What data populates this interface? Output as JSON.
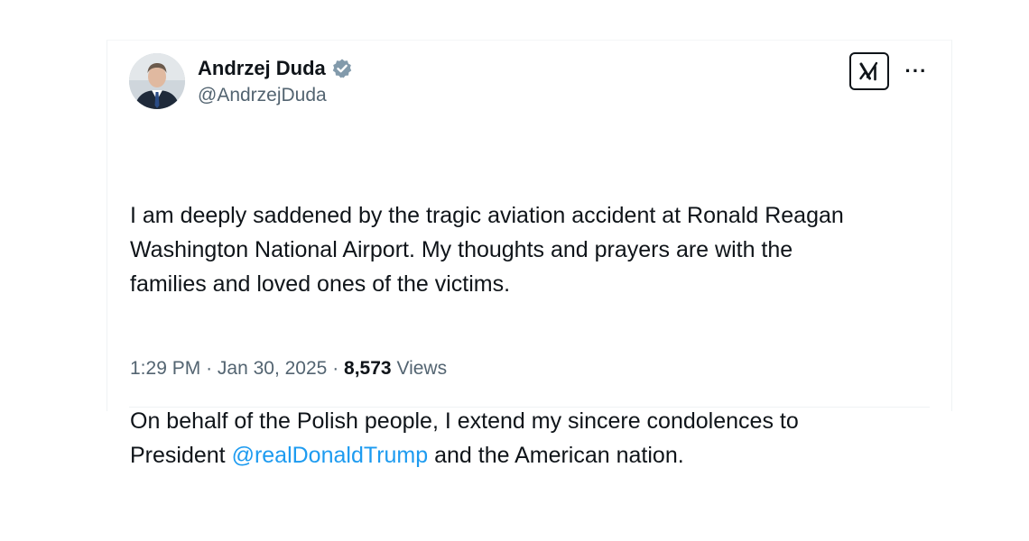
{
  "author": {
    "display_name": "Andrzej Duda",
    "handle": "@AndrzejDuda",
    "verified": true,
    "avatar": "profile-photo"
  },
  "actions": {
    "grok_icon": "grok-icon",
    "more_icon": "more-options-icon",
    "more_label": "···"
  },
  "tweet": {
    "paragraph1": "I am deeply saddened by the tragic aviation accident at Ronald Reagan\nWashington National Airport. My thoughts and prayers are with the\nfamilies and loved ones of the victims.",
    "paragraph2_before": "On behalf of the Polish people, I extend my sincere condolences to\nPresident ",
    "mention": "@realDonaldTrump",
    "paragraph2_after": " and the American nation."
  },
  "meta": {
    "time": "1:29 PM",
    "separator": "·",
    "date": "Jan 30, 2025",
    "views_count": "8,573",
    "views_label": "Views"
  },
  "colors": {
    "link": "#1d9bf0",
    "secondary_text": "#536471",
    "verified_badge": "#829aab"
  }
}
